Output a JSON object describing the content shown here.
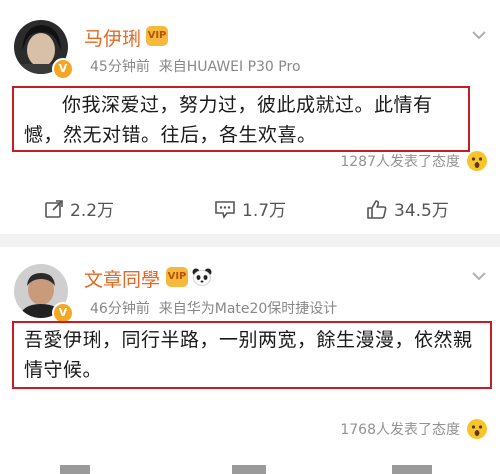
{
  "posts": [
    {
      "author": "马伊琍",
      "time": "45分钟前",
      "source": "来自HUAWEI P30 Pro",
      "content": "你我深爱过，努力过，彼此成就过。此情有憾，然无对错。往后，各生欢喜。",
      "reactions_text": "1287人发表了态度",
      "actions": {
        "repost": "2.2万",
        "comment": "1.7万",
        "like": "34.5万"
      }
    },
    {
      "author": "文章同學",
      "time": "46分钟前",
      "source": "来自华为Mate20保时捷设计",
      "content": "吾愛伊琍，同行半路，一别两宽，餘生漫漫，依然親情守候。",
      "reactions_text": "1768人发表了态度"
    }
  ],
  "colors": {
    "name": "#e86722",
    "highlight_border": "#c81c24",
    "meta": "#888888",
    "background": "#f2f2f2"
  },
  "icons": {
    "repost": "repost-icon",
    "comment": "comment-icon",
    "like": "thumbs-up-icon",
    "reaction": "surprised-face-icon",
    "verified": "verified-v-icon",
    "more": "chevron-down-icon"
  }
}
